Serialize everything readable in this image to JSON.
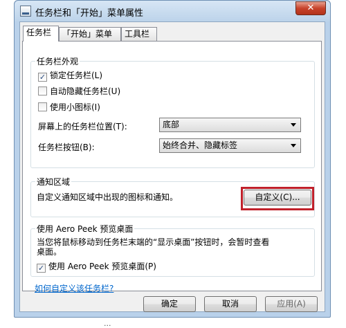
{
  "window": {
    "title": "任务栏和「开始」菜单属性",
    "close_glyph": "✕"
  },
  "tabs": [
    "任务栏",
    "「开始」菜单",
    "工具栏"
  ],
  "appearance": {
    "group_label": "任务栏外观",
    "lock_label": "锁定任务栏(L)",
    "lock_checked": true,
    "autohide_label": "自动隐藏任务栏(U)",
    "autohide_checked": false,
    "small_icons_label": "使用小图标(I)",
    "small_icons_checked": false,
    "position_label": "屏幕上的任务栏位置(T):",
    "position_value": "底部",
    "buttons_label": "任务栏按钮(B):",
    "buttons_value": "始终合并、隐藏标签"
  },
  "notification": {
    "group_label": "通知区域",
    "description": "自定义通知区域中出现的图标和通知。",
    "customize_button": "自定义(C)..."
  },
  "aero_peek": {
    "group_label": "使用 Aero Peek 预览桌面",
    "description_line1": "当您将鼠标移动到任务栏末端的“显示桌面”按钮时，会暂时查看",
    "description_line2": "桌面。",
    "checkbox_label": "使用 Aero Peek 预览桌面(P)",
    "checked": true
  },
  "help_link": "如何自定义该任务栏?",
  "footer": {
    "ok": "确定",
    "cancel": "取消",
    "apply": "应用(A)"
  },
  "caption_fragment": "...",
  "colors": {
    "highlight_box": "#c0202a",
    "link": "#0066cc",
    "frame": "#b9d1ea"
  }
}
